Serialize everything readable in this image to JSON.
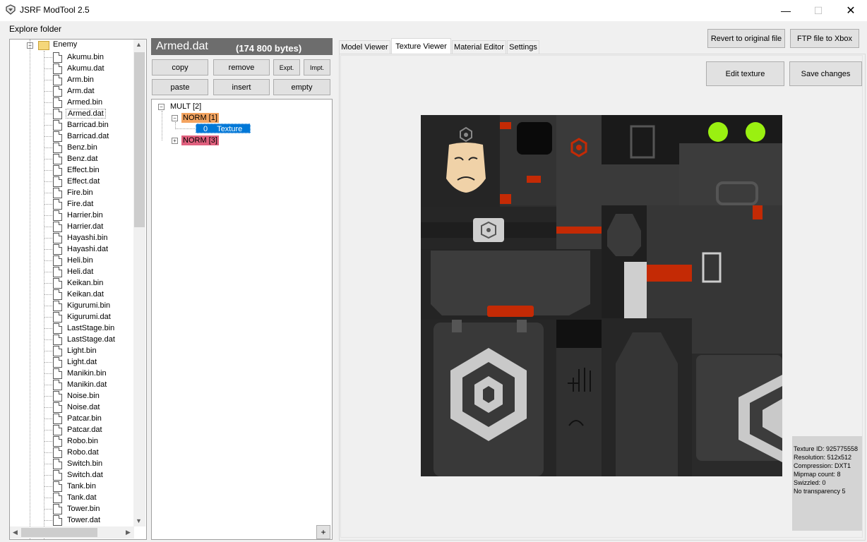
{
  "window": {
    "title": "JSRF ModTool 2.5"
  },
  "menu": {
    "explore_folder": "Explore folder"
  },
  "tree": {
    "root_folder": "Enemy",
    "files": [
      "Akumu.bin",
      "Akumu.dat",
      "Arm.bin",
      "Arm.dat",
      "Armed.bin",
      "Armed.dat",
      "Barricad.bin",
      "Barricad.dat",
      "Benz.bin",
      "Benz.dat",
      "Effect.bin",
      "Effect.dat",
      "Fire.bin",
      "Fire.dat",
      "Harrier.bin",
      "Harrier.dat",
      "Hayashi.bin",
      "Hayashi.dat",
      "Heli.bin",
      "Heli.dat",
      "Keikan.bin",
      "Keikan.dat",
      "Kigurumi.bin",
      "Kigurumi.dat",
      "LastStage.bin",
      "LastStage.dat",
      "Light.bin",
      "Light.dat",
      "Manikin.bin",
      "Manikin.dat",
      "Noise.bin",
      "Noise.dat",
      "Patcar.bin",
      "Patcar.dat",
      "Robo.bin",
      "Robo.dat",
      "Switch.bin",
      "Switch.dat",
      "Tank.bin",
      "Tank.dat",
      "Tower.bin",
      "Tower.dat"
    ],
    "selected": "Armed.dat"
  },
  "file_header": {
    "name": "Armed.dat",
    "size": "(174 800 bytes)"
  },
  "buttons": {
    "copy": "copy",
    "remove": "remove",
    "export": "Expt.",
    "import": "Impt.",
    "paste": "paste",
    "insert": "insert",
    "empty": "empty",
    "add": "+"
  },
  "nodes": {
    "root": "MULT [2]",
    "norm1": "NORM [1]",
    "texture_index": "0",
    "texture_label": "Texture",
    "norm3": "NORM [3]"
  },
  "tabs": [
    "Model Viewer",
    "Texture Viewer",
    "Material Editor",
    "Settings"
  ],
  "active_tab": "Texture Viewer",
  "top_actions": {
    "revert": "Revert to original file",
    "ftp": "FTP file to Xbox"
  },
  "texture_actions": {
    "edit": "Edit texture",
    "save": "Save changes"
  },
  "texture_info": [
    "Texture ID: 925775558",
    "Resolution: 512x512",
    "Compression: DXT1",
    "Mipmap count: 8",
    "Swizzled: 0",
    "No transparency 5"
  ],
  "colors": {
    "norm1_bg": "#f4a460",
    "norm3_bg": "#e0607e",
    "selection_bg": "#0078d7",
    "texture_red": "#c42a05",
    "texture_green": "#9af011"
  }
}
